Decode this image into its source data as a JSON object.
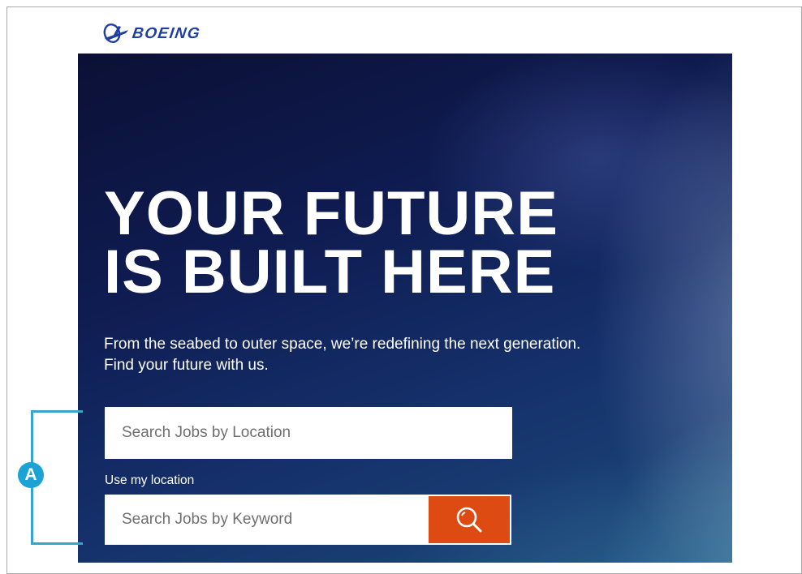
{
  "brand": {
    "name": "BOEING",
    "logo_color": "#1f3e9e"
  },
  "hero": {
    "headline_line1": "YOUR FUTURE",
    "headline_line2": "IS BUILT HERE",
    "subtitle_line1": "From the seabed to outer space, we’re redefining the next generation.",
    "subtitle_line2": "Find your future with us."
  },
  "search": {
    "location_placeholder": "Search Jobs by Location",
    "use_location_label": "Use my location",
    "keyword_placeholder": "Search Jobs by Keyword",
    "button_icon": "search-icon",
    "button_color": "#dd4a12"
  },
  "annotation": {
    "label": "A",
    "color": "#3aa2cf"
  }
}
